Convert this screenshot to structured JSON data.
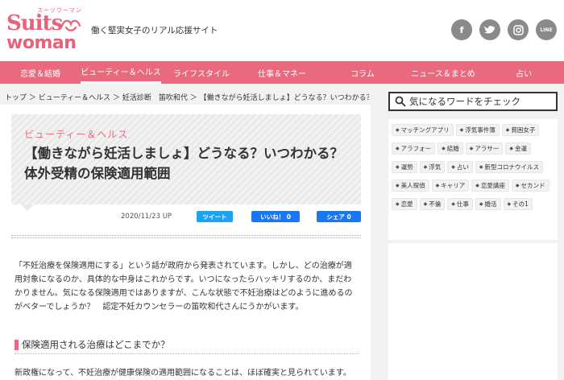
{
  "header": {
    "logo_small": "スーツウーマン",
    "logo_top": "Suits",
    "logo_bottom": "woman",
    "tagline": "働く堅実女子のリアル応援サイト",
    "social": [
      {
        "icon": "facebook-icon",
        "glyph": "f"
      },
      {
        "icon": "twitter-icon",
        "glyph": "t"
      },
      {
        "icon": "instagram-icon",
        "glyph": "◎"
      },
      {
        "icon": "line-icon",
        "glyph": "LINE"
      }
    ]
  },
  "nav": {
    "items": [
      {
        "label": "恋愛＆結婚",
        "active": false
      },
      {
        "label": "ビューティー＆ヘルス",
        "active": true
      },
      {
        "label": "ライフスタイル",
        "active": false
      },
      {
        "label": "仕事＆マネー",
        "active": false
      },
      {
        "label": "コラム",
        "active": false
      },
      {
        "label": "ニュース＆まとめ",
        "active": false
      },
      {
        "label": "占い",
        "active": false
      }
    ]
  },
  "breadcrumb": "トップ ＞ ビューティー＆ヘルス ＞ 妊活診断　笛吹和代 ＞ 【働きながら妊活しましょ】どうなる？いつわかる？体...",
  "article": {
    "category": "ビューティー＆ヘルス",
    "title": "【働きながら妊活しましょ】どうなる？いつわかる？体外受精の保険適用範囲",
    "date": "2020/11/23 UP",
    "share": {
      "tweet": "ツイート",
      "like": "いいね！ 0",
      "fb_share": "シェア 0"
    },
    "body": "「不妊治療を保険適用にする」という話が政府から発表されています。しかし、どの治療が適用対象になるのか、具体的な中身はこれからです。いつになったらハッキリするのか、まだわかりません。気になる保険適用ではありますが、こんな状態で不妊治療はどのように進めるのがベターでしょうか？　認定不妊カウンセラーの笛吹和代さんにうかがいます。",
    "h2": "保険適用される治療はどこまでか？",
    "text2": "新政権になって、不妊治療が健康保険の適用範囲になることは、ほぼ確実と見られています。"
  },
  "sidebar": {
    "search_placeholder": "気になるワードをチェック",
    "tags": [
      "マッチングアプリ",
      "浮気事件簿",
      "貧困女子",
      "アラフォー",
      "結婚",
      "アラサー",
      "金運",
      "運勢",
      "浮気",
      "占い",
      "新型コロナウイルス",
      "美人探偵",
      "キャリア",
      "恋愛講座",
      "セカンド",
      "恋愛",
      "不倫",
      "仕事",
      "婚活",
      "その1"
    ]
  },
  "colors": {
    "accent": "#e9697f",
    "twitter": "#1da1f2",
    "facebook": "#1877f2"
  }
}
